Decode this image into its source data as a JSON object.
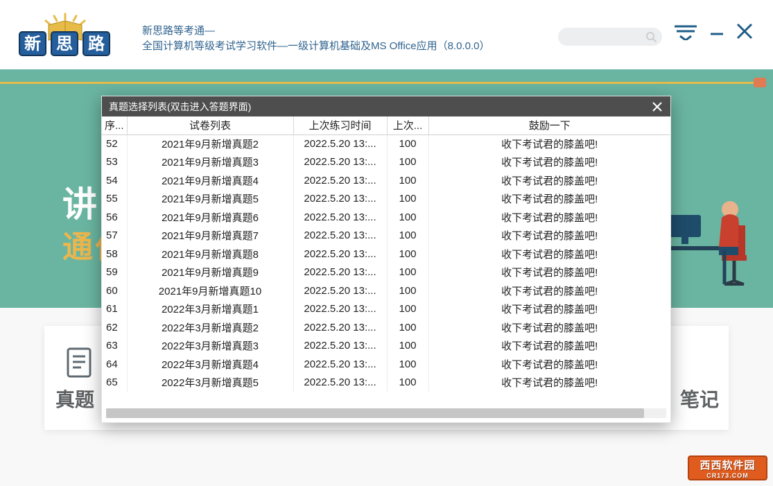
{
  "header": {
    "title_line1": "新思路等考通—",
    "title_line2": "全国计算机等级考试学习软件—一级计算机基础及MS Office应用（8.0.0.0）"
  },
  "background": {
    "big_text_1": "讲角",
    "big_text_2": "通伯",
    "bottom_left": "真题",
    "bottom_right": "笔记"
  },
  "watermark": {
    "line1": "西西软件园",
    "line2": "CR173.COM"
  },
  "modal": {
    "title": "真题选择列表(双击进入答题界面)",
    "columns": {
      "seq": "序...",
      "paper": "试卷列表",
      "time": "上次练习时间",
      "score": "上次...",
      "encourage": "鼓励一下"
    },
    "rows": [
      {
        "seq": "52",
        "paper": "2021年9月新增真题2",
        "time": "2022.5.20  13:...",
        "score": "100",
        "encourage": "收下考试君的膝盖吧!"
      },
      {
        "seq": "53",
        "paper": "2021年9月新增真题3",
        "time": "2022.5.20  13:...",
        "score": "100",
        "encourage": "收下考试君的膝盖吧!"
      },
      {
        "seq": "54",
        "paper": "2021年9月新增真题4",
        "time": "2022.5.20  13:...",
        "score": "100",
        "encourage": "收下考试君的膝盖吧!"
      },
      {
        "seq": "55",
        "paper": "2021年9月新增真题5",
        "time": "2022.5.20  13:...",
        "score": "100",
        "encourage": "收下考试君的膝盖吧!"
      },
      {
        "seq": "56",
        "paper": "2021年9月新增真题6",
        "time": "2022.5.20  13:...",
        "score": "100",
        "encourage": "收下考试君的膝盖吧!"
      },
      {
        "seq": "57",
        "paper": "2021年9月新增真题7",
        "time": "2022.5.20  13:...",
        "score": "100",
        "encourage": "收下考试君的膝盖吧!"
      },
      {
        "seq": "58",
        "paper": "2021年9月新增真题8",
        "time": "2022.5.20  13:...",
        "score": "100",
        "encourage": "收下考试君的膝盖吧!"
      },
      {
        "seq": "59",
        "paper": "2021年9月新增真题9",
        "time": "2022.5.20  13:...",
        "score": "100",
        "encourage": "收下考试君的膝盖吧!"
      },
      {
        "seq": "60",
        "paper": "2021年9月新增真题10",
        "time": "2022.5.20  13:...",
        "score": "100",
        "encourage": "收下考试君的膝盖吧!"
      },
      {
        "seq": "61",
        "paper": "2022年3月新增真题1",
        "time": "2022.5.20  13:...",
        "score": "100",
        "encourage": "收下考试君的膝盖吧!"
      },
      {
        "seq": "62",
        "paper": "2022年3月新增真题2",
        "time": "2022.5.20  13:...",
        "score": "100",
        "encourage": "收下考试君的膝盖吧!"
      },
      {
        "seq": "63",
        "paper": "2022年3月新增真题3",
        "time": "2022.5.20  13:...",
        "score": "100",
        "encourage": "收下考试君的膝盖吧!"
      },
      {
        "seq": "64",
        "paper": "2022年3月新增真题4",
        "time": "2022.5.20  13:...",
        "score": "100",
        "encourage": "收下考试君的膝盖吧!"
      },
      {
        "seq": "65",
        "paper": "2022年3月新增真题5",
        "time": "2022.5.20  13:...",
        "score": "100",
        "encourage": "收下考试君的膝盖吧!"
      }
    ]
  }
}
